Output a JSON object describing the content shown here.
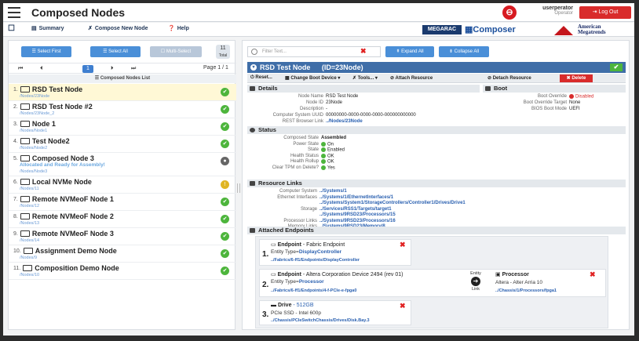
{
  "header": {
    "title": "Composed Nodes",
    "user_name": "userperator",
    "user_role": "Operator",
    "logout": "Log Out"
  },
  "toolbar": {
    "summary": "Summary",
    "compose": "Compose New Node",
    "help": "Help",
    "megarac": "MEGARAC",
    "composer": "Composer",
    "ami_line1": "American",
    "ami_line2": "Megatrends"
  },
  "left": {
    "select_first": "Select First",
    "select_all": "Select All",
    "multi_select": "Multi-Select",
    "total_count": "11",
    "total_label": "Total",
    "pager": {
      "first": "⏮",
      "prev": "⏴",
      "current": "1",
      "next": "⏵",
      "last": "⏭",
      "page_label": "Page 1 / 1"
    },
    "list_header": "Composed Nodes List",
    "items": [
      {
        "num": "1.",
        "name": "RSD Test Node",
        "sub": "/Nodes/23Node",
        "status": "ok"
      },
      {
        "num": "2.",
        "name": "RSD Test Node #2",
        "sub": "/Nodes/23Node_2",
        "status": "ok"
      },
      {
        "num": "3.",
        "name": "Node 1",
        "sub": "/Nodes/Node1",
        "status": "ok"
      },
      {
        "num": "4.",
        "name": "Test Node2",
        "sub": "/Nodes/Node2",
        "status": "ok"
      },
      {
        "num": "5.",
        "name": "Composed Node 3",
        "warn": "Allocated and Ready for Assembly!",
        "sub": "/Nodes/Node3",
        "status": "off"
      },
      {
        "num": "6.",
        "name": "Local NVMe Node",
        "sub": "/Nodes/11",
        "status": "wt"
      },
      {
        "num": "7.",
        "name": "Remote NVMeoF Node 1",
        "sub": "/Nodes/12",
        "status": "ok"
      },
      {
        "num": "8.",
        "name": "Remote NVMeoF Node 2",
        "sub": "/Nodes/13",
        "status": "ok"
      },
      {
        "num": "9.",
        "name": "Remote NVMeoF Node 3",
        "sub": "/Nodes/14",
        "status": "ok"
      },
      {
        "num": "10.",
        "name": "Assignment Demo Node",
        "sub": "/Nodes/9",
        "status": "ok"
      },
      {
        "num": "11.",
        "name": "Composition Demo Node",
        "sub": "/Nodes/10",
        "status": "ok"
      }
    ]
  },
  "right": {
    "filter_placeholder": "Filter Text...",
    "expand_all": "Expand All",
    "collapse_all": "Collapse All",
    "node_title": "RSD Test Node",
    "node_id": "(ID=23Node)",
    "actions": {
      "reset": "Reset...",
      "boot": "Change Boot Device",
      "tools": "Tools...",
      "attach": "Attach Resource",
      "detach": "Detach Resource",
      "delete": "Delete"
    },
    "details": {
      "title": "Details",
      "rows": [
        {
          "k": "Node Name",
          "v": "RSD Test Node"
        },
        {
          "k": "Node ID",
          "v": "23Node"
        },
        {
          "k": "Description",
          "v": "-"
        },
        {
          "k": "Computer System UUID",
          "v": "00000000-0000-0000-0000-000000000000"
        },
        {
          "k": "REST Browser Link",
          "v": "../Nodes/23Node"
        }
      ]
    },
    "boot": {
      "title": "Boot",
      "rows": [
        {
          "k": "Boot Override",
          "v": "Disabled"
        },
        {
          "k": "Boot Override Target",
          "v": "None"
        },
        {
          "k": "BIOS Boot Mode",
          "v": "UEFI"
        }
      ]
    },
    "status": {
      "title": "Status",
      "rows": [
        {
          "k": "Composed State",
          "v": "Assembled"
        },
        {
          "k": "Power State",
          "v": "On"
        },
        {
          "k": "State",
          "v": "Enabled"
        },
        {
          "k": "Health Status",
          "v": "OK"
        },
        {
          "k": "Health Rollup",
          "v": "OK"
        },
        {
          "k": "Clear TPM on Delete?",
          "v": "Yes"
        }
      ]
    },
    "resources": {
      "title": "Resource Links",
      "rows": [
        {
          "k": "Computer System",
          "v": "../Systems/1"
        },
        {
          "k": "Ethernet Interfaces",
          "v": "../Systems/1/EthernetInterfaces/1"
        },
        {
          "k": "",
          "v": "../Systems/System1/StorageControllers/Controller1/Drives/Drive1"
        },
        {
          "k": "Storage",
          "v": "../Services/RSS1/Targets/target1"
        },
        {
          "k": "",
          "v": "../Systems/9RSD23/Processors/15"
        },
        {
          "k": "Processor Links",
          "v": "../Systems/9RSD23/Processors/16"
        },
        {
          "k": "Memory Links",
          "v": "../Systems/9RSD23/Memory/8"
        }
      ]
    },
    "endpoints": {
      "title": "Attached Endpoints",
      "ep1": {
        "num": "1.",
        "title": "Endpoint",
        "desc": "- Fabric Endpoint",
        "type_k": "Entity Type=",
        "type_v": "DisplayController",
        "link": "../Fabrics/6-ff1/Endpoints/DisplayController"
      },
      "ep2": {
        "num": "2.",
        "title": "Endpoint",
        "desc": "- Altera Corporation Device 2494 (rev 01)",
        "type_k": "Entity Type=",
        "type_v": "Processor",
        "link": "../Fabrics/6-ff1/Endpoints/4-f-PCIe-e-fpga0",
        "entity": "Entity",
        "link_lbl": "Link",
        "proc_title": "Processor",
        "proc_desc": "Altera - Alter Arria 10",
        "proc_link": "../Chassis/1/Processors/fpga1"
      },
      "ep3": {
        "num": "3.",
        "title": "Drive",
        "size": "- 512GB",
        "desc": "PCIe SSD - Intel 600p",
        "link": "../Chassis/PCIeSwitchChassis/Drives/Disk.Bay.3"
      }
    }
  }
}
